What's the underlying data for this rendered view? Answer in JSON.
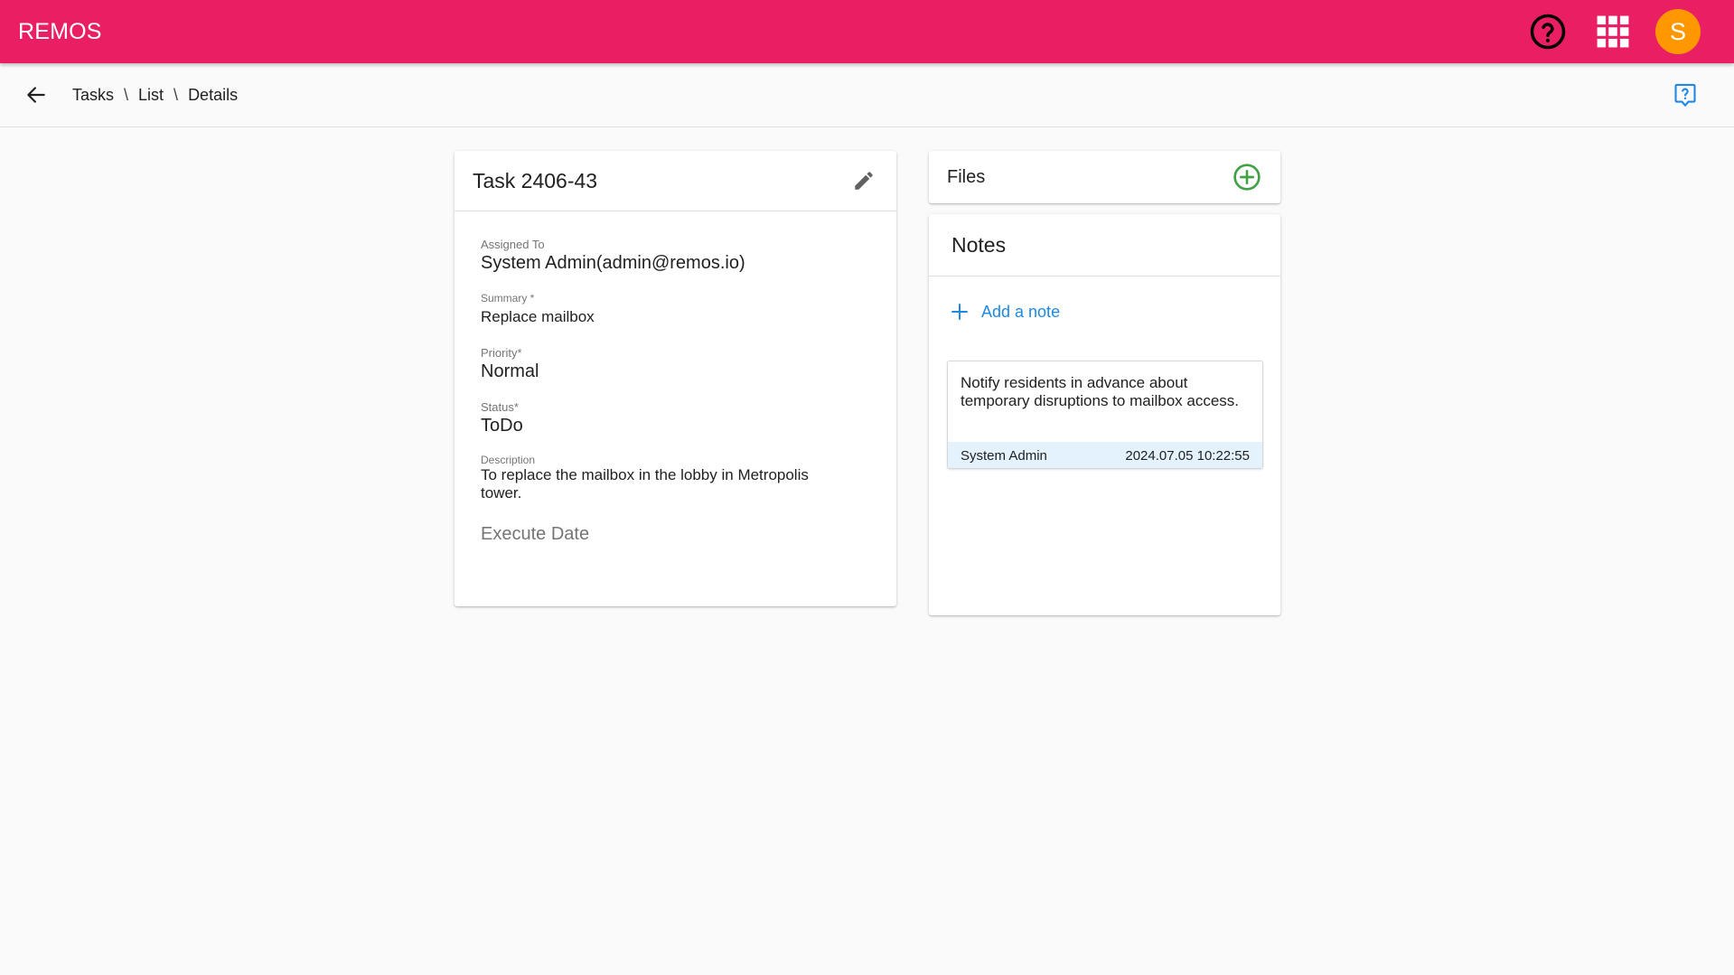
{
  "app": {
    "brand": "REMOS",
    "user_initial": "S",
    "colors": {
      "primary": "#e91e63",
      "avatar": "#ff9800",
      "link": "#1e88e5",
      "success": "#43a047",
      "note_footer": "#e3f2fd"
    },
    "icons": {
      "help": "help-circle-icon",
      "apps": "apps-grid-icon",
      "back": "arrow-left-icon",
      "page_help": "help-box-icon",
      "edit": "pencil-icon",
      "add_file": "plus-circle-icon",
      "add_note": "plus-icon"
    }
  },
  "breadcrumb": {
    "items": [
      "Tasks",
      "List",
      "Details"
    ],
    "separator": "\\"
  },
  "task": {
    "title": "Task 2406-43",
    "assigned_to_label": "Assigned To",
    "assigned_to": "System Admin(admin@remos.io)",
    "summary_label": "Summary *",
    "summary": "Replace mailbox",
    "priority_label": "Priority*",
    "priority": "Normal",
    "status_label": "Status*",
    "status": "ToDo",
    "description_label": "Description",
    "description": "To replace the mailbox in the lobby in Metropolis tower.",
    "execute_date_label": "Execute Date"
  },
  "files": {
    "title": "Files"
  },
  "notes": {
    "title": "Notes",
    "add_label": "Add a note",
    "items": [
      {
        "text": "Notify residents in advance about temporary disruptions to mailbox access.",
        "author": "System Admin",
        "timestamp": "2024.07.05 10:22:55"
      }
    ]
  }
}
